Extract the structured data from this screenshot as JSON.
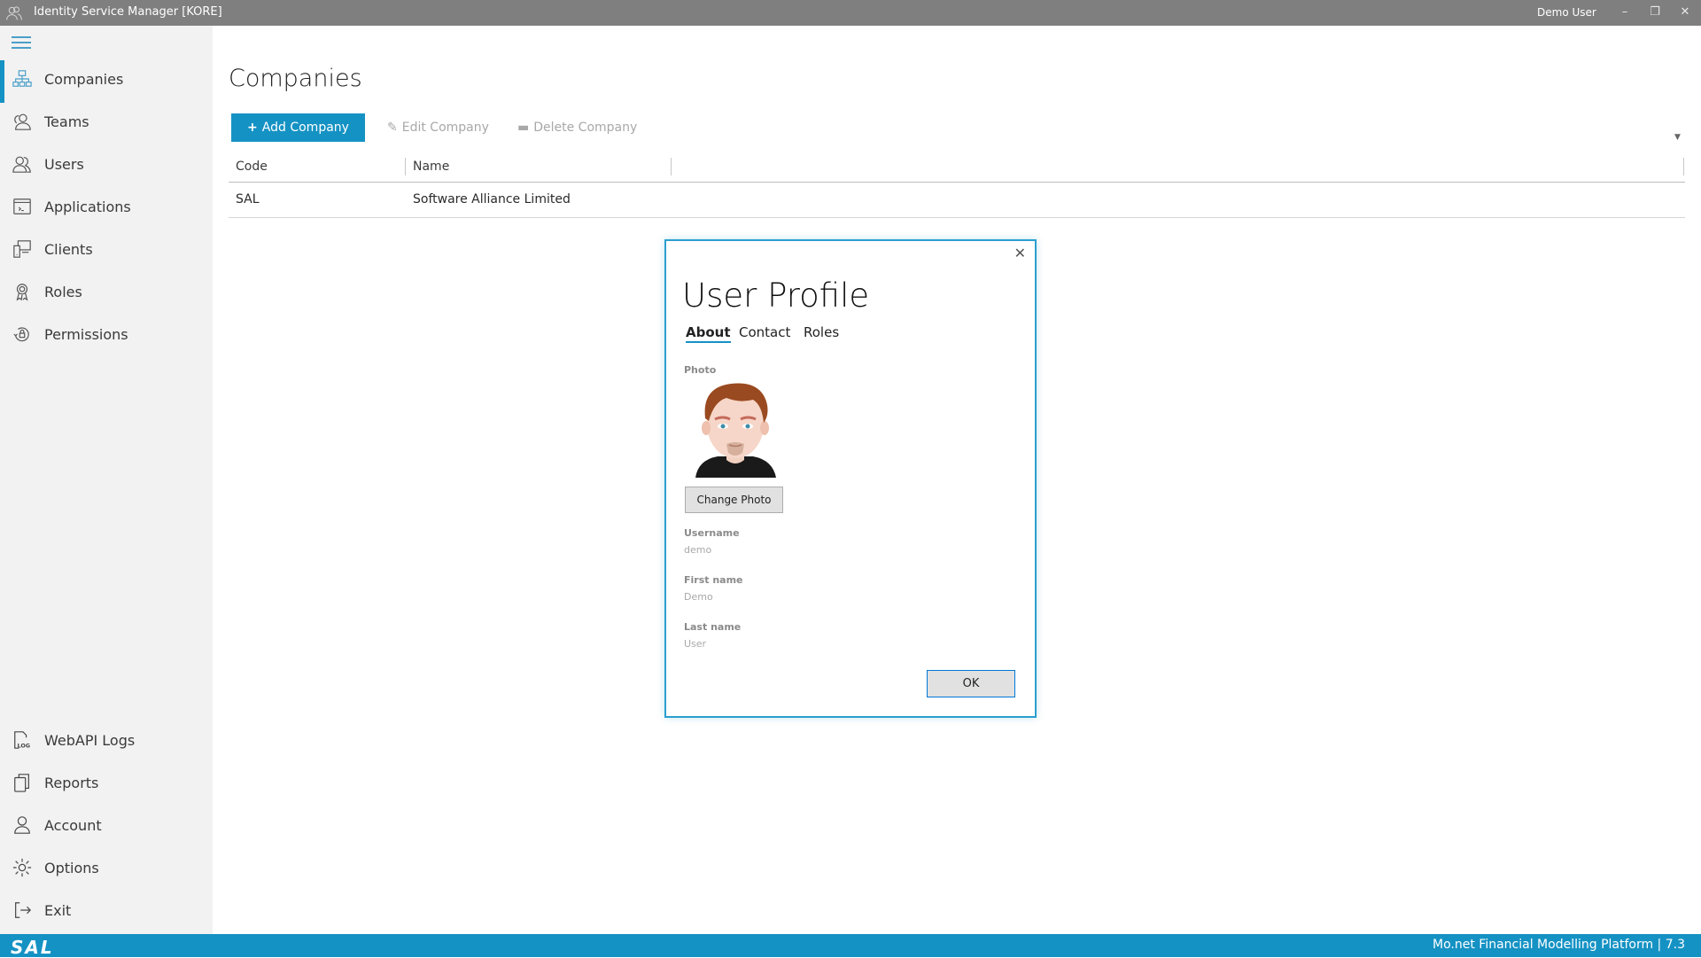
{
  "titlebar": {
    "title": "Identity Service Manager [KORE]",
    "user": "Demo User",
    "minimize": "–",
    "restore": "❐",
    "close": "✕"
  },
  "sidebar": {
    "items": [
      {
        "label": "Companies",
        "icon": "org-chart-icon",
        "active": true
      },
      {
        "label": "Teams",
        "icon": "team-icon"
      },
      {
        "label": "Users",
        "icon": "users-icon"
      },
      {
        "label": "Applications",
        "icon": "terminal-window-icon"
      },
      {
        "label": "Clients",
        "icon": "devices-icon"
      },
      {
        "label": "Roles",
        "icon": "badge-icon"
      },
      {
        "label": "Permissions",
        "icon": "lock-refresh-icon"
      }
    ],
    "bottom_items": [
      {
        "label": "WebAPI Logs",
        "icon": "log-file-icon"
      },
      {
        "label": "Reports",
        "icon": "reports-icon"
      },
      {
        "label": "Account",
        "icon": "account-icon"
      },
      {
        "label": "Options",
        "icon": "gear-icon"
      },
      {
        "label": "Exit",
        "icon": "exit-icon"
      }
    ]
  },
  "main": {
    "title": "Companies",
    "toolbar": {
      "add_label": "Add Company",
      "edit_label": "Edit Company",
      "delete_label": "Delete Company"
    },
    "table": {
      "columns": [
        "Code",
        "Name"
      ],
      "rows": [
        {
          "code": "SAL",
          "name": "Software Alliance Limited"
        }
      ]
    }
  },
  "dialog": {
    "title": "User Profile",
    "tabs": [
      "About",
      "Contact",
      "Roles"
    ],
    "active_tab": "About",
    "photo_label": "Photo",
    "change_photo_label": "Change Photo",
    "fields": [
      {
        "label": "Username",
        "value": "demo"
      },
      {
        "label": "First name",
        "value": "Demo"
      },
      {
        "label": "Last name",
        "value": "User"
      }
    ],
    "ok_label": "OK",
    "close": "✕"
  },
  "footer": {
    "logo": "SAL",
    "text": "Mo.net Financial Modelling Platform | 7.3"
  },
  "colors": {
    "accent": "#1592c4",
    "titlebar": "#7f7f7f",
    "sidebar": "#f2f2f2"
  }
}
